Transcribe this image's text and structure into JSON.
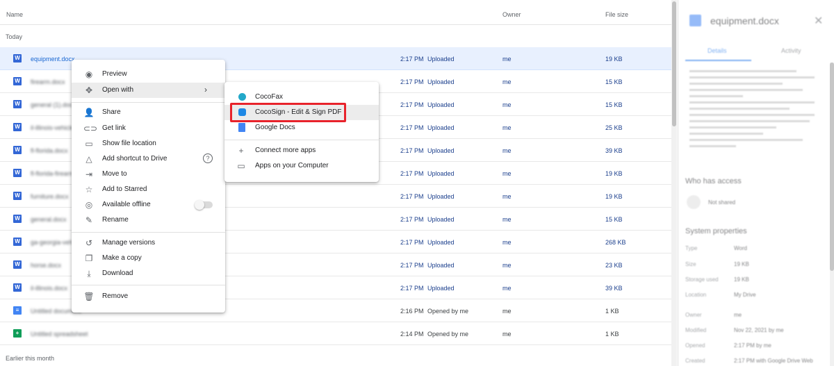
{
  "columns": {
    "name": "Name",
    "owner": "Owner",
    "size": "File size"
  },
  "sections": {
    "today": "Today",
    "earlier": "Earlier this month"
  },
  "files": [
    {
      "name": "equipment.docx",
      "icon": "word-icon",
      "time": "2:17 PM",
      "status": "Uploaded",
      "owner": "me",
      "size": "19 KB"
    },
    {
      "name": "firearm.docx",
      "icon": "word-icon",
      "time": "2:17 PM",
      "status": "Uploaded",
      "owner": "me",
      "size": "15 KB"
    },
    {
      "name": "general (1).docx",
      "icon": "word-icon",
      "time": "2:17 PM",
      "status": "Uploaded",
      "owner": "me",
      "size": "15 KB"
    },
    {
      "name": "il-illinois-vehicle",
      "icon": "word-icon",
      "time": "2:17 PM",
      "status": "Uploaded",
      "owner": "me",
      "size": "25 KB"
    },
    {
      "name": "fl-florida.docx",
      "icon": "word-icon",
      "time": "2:17 PM",
      "status": "Uploaded",
      "owner": "me",
      "size": "39 KB"
    },
    {
      "name": "fl-florida-firearm",
      "icon": "word-icon",
      "time": "2:17 PM",
      "status": "Uploaded",
      "owner": "me",
      "size": "19 KB"
    },
    {
      "name": "furniture.docx",
      "icon": "word-icon",
      "time": "2:17 PM",
      "status": "Uploaded",
      "owner": "me",
      "size": "19 KB"
    },
    {
      "name": "general.docx",
      "icon": "word-icon",
      "time": "2:17 PM",
      "status": "Uploaded",
      "owner": "me",
      "size": "15 KB"
    },
    {
      "name": "ga-georgia-vehicle",
      "icon": "word-icon",
      "time": "2:17 PM",
      "status": "Uploaded",
      "owner": "me",
      "size": "268 KB"
    },
    {
      "name": "horse.docx",
      "icon": "word-icon",
      "time": "2:17 PM",
      "status": "Uploaded",
      "owner": "me",
      "size": "23 KB"
    },
    {
      "name": "il-illinois.docx",
      "icon": "word-icon",
      "time": "2:17 PM",
      "status": "Uploaded",
      "owner": "me",
      "size": "39 KB"
    },
    {
      "name": "Untitled document",
      "icon": "docs-icon",
      "time": "2:16 PM",
      "status": "Opened by me",
      "owner": "me",
      "size": "1 KB"
    },
    {
      "name": "Untitled spreadsheet",
      "icon": "sheets-icon",
      "time": "2:14 PM",
      "status": "Opened by me",
      "owner": "me",
      "size": "1 KB"
    }
  ],
  "context_menu": {
    "preview": "Preview",
    "open_with": "Open with",
    "share": "Share",
    "get_link": "Get link",
    "show_location": "Show file location",
    "add_shortcut": "Add shortcut to Drive",
    "move_to": "Move to",
    "add_starred": "Add to Starred",
    "available_offline": "Available offline",
    "rename": "Rename",
    "manage_versions": "Manage versions",
    "make_copy": "Make a copy",
    "download": "Download",
    "remove": "Remove",
    "help_glyph": "?"
  },
  "open_with_menu": {
    "cocofax": "CocoFax",
    "cocosign": "CocoSign - Edit & Sign PDF",
    "google_docs": "Google Docs",
    "connect_more": "Connect more apps",
    "apps_on_computer": "Apps on your Computer"
  },
  "details_panel": {
    "title": "equipment.docx",
    "tab_details": "Details",
    "tab_activity": "Activity",
    "who_has_access": "Who has access",
    "not_shared": "Not shared",
    "system_properties": "System properties",
    "props": [
      {
        "key": "Type",
        "value": "Word"
      },
      {
        "key": "Size",
        "value": "19 KB"
      },
      {
        "key": "Storage used",
        "value": "19 KB"
      },
      {
        "key": "Location",
        "value": "My Drive"
      },
      {
        "key": "Owner",
        "value": "me"
      },
      {
        "key": "Modified",
        "value": "Nov 22, 2021 by me"
      },
      {
        "key": "Opened",
        "value": "2:17 PM by me"
      },
      {
        "key": "Created",
        "value": "2:17 PM with Google Drive Web"
      }
    ]
  },
  "colors": {
    "accent": "#1a73e8",
    "highlight_red": "#e8232b",
    "selected_row": "#e8f0fe"
  }
}
